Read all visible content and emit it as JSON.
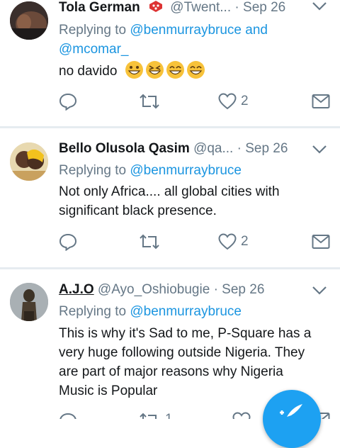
{
  "tweets": [
    {
      "name": "Tola German",
      "handle": "@Twent...",
      "date": "Sep 26",
      "reply_prefix": "Replying to",
      "reply_mentions": [
        "@benmurraybruce and",
        "@mcomar_"
      ],
      "text": "no davido",
      "like_count": "2",
      "retweet_count": ""
    },
    {
      "name": "Bello Olusola Qasim",
      "handle": "@qa...",
      "date": "Sep 26",
      "reply_prefix": "Replying to",
      "reply_mentions": [
        "@benmurraybruce"
      ],
      "text": [
        "Not only Africa.... all global cities with",
        "significant black presence."
      ],
      "like_count": "2",
      "retweet_count": ""
    },
    {
      "name": "A.J.O",
      "handle": "@Ayo_Oshiobugie",
      "date": "Sep 26",
      "reply_prefix": "Replying to",
      "reply_mentions": [
        "@benmurraybruce"
      ],
      "text": [
        "This is why it's Sad to me, P-Square has a",
        "very huge following outside Nigeria. They",
        "are part of major reasons why Nigeria",
        "Music is Popular"
      ],
      "like_count": "",
      "retweet_count": "1"
    }
  ],
  "separator": "·",
  "icons": {
    "reply": "reply-icon",
    "retweet": "retweet-icon",
    "like": "heart-icon",
    "dm": "mail-icon",
    "caret": "chevron-down-icon",
    "compose": "compose-tweet-icon"
  },
  "colors": {
    "accent": "#1da1f2",
    "link": "#1b95e0",
    "muted": "#657786",
    "divider": "#e6ecf0"
  }
}
